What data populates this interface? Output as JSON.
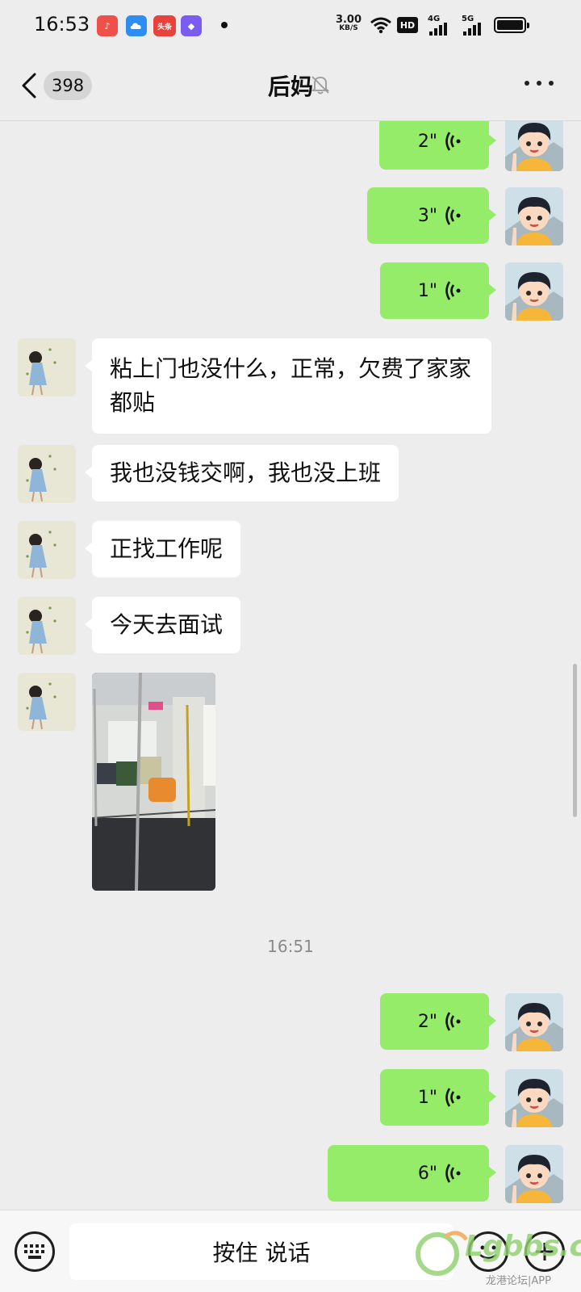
{
  "status_bar": {
    "time": "16:53",
    "apps": [
      {
        "name": "music-app-icon",
        "color": "#f0504a",
        "glyph": "♪"
      },
      {
        "name": "cloud-app-icon",
        "color": "#2f8cf0",
        "glyph": ""
      },
      {
        "name": "toutiao-app-icon",
        "color": "#e8423a",
        "glyph": "头条"
      },
      {
        "name": "shortcut-app-icon",
        "color": "#7a5cf0",
        "glyph": "◆"
      }
    ],
    "speed_value": "3.00",
    "speed_unit": "KB/S",
    "hd_label": "HD",
    "network_1": "4G",
    "network_2": "5G"
  },
  "header": {
    "unread_count": "398",
    "title": "后妈"
  },
  "messages": {
    "out_voice_1": "2\"",
    "out_voice_2": "3\"",
    "out_voice_3": "1\"",
    "in_text_1": "粘上门也没什么，正常，欠费了家家都贴",
    "in_text_2": "我也没钱交啊，我也没上班",
    "in_text_3": "正找工作呢",
    "in_text_4": "今天去面试",
    "timestamp": "16:51",
    "out_voice_4": "2\"",
    "out_voice_5": "1\"",
    "out_voice_6": "6\""
  },
  "input_bar": {
    "talk_label": "按住 说话"
  },
  "watermark": {
    "brand": "Lgbbs.cn",
    "sub": "龙港论坛|APP"
  },
  "colors": {
    "outgoing_bubble": "#95ec69",
    "incoming_bubble": "#ffffff",
    "background": "#ededed"
  }
}
